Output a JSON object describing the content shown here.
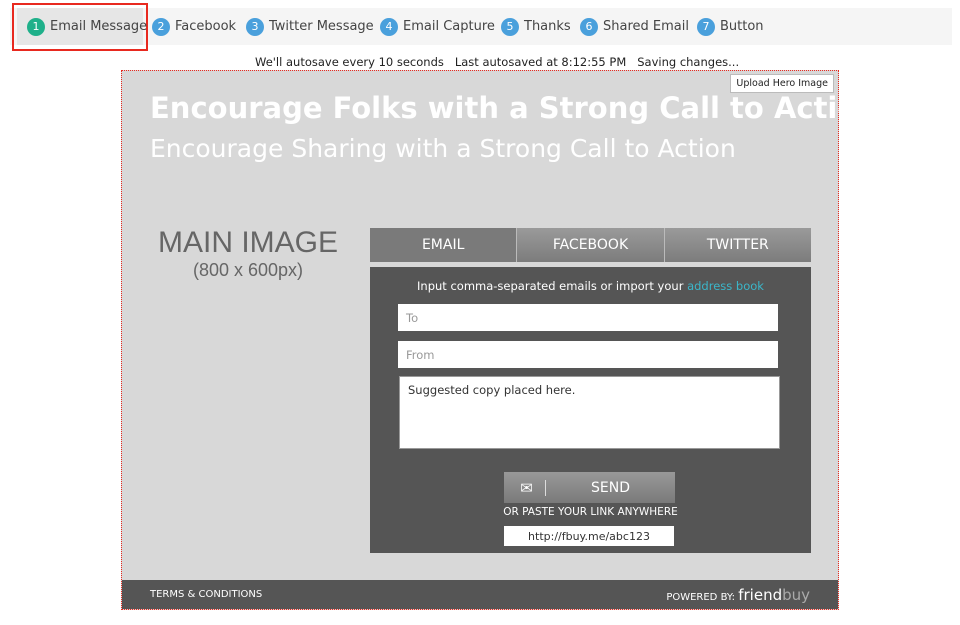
{
  "nav": {
    "items": [
      {
        "num": "1",
        "label": "Email Message",
        "color": "#1fb08a"
      },
      {
        "num": "2",
        "label": "Facebook"
      },
      {
        "num": "3",
        "label": "Twitter Message"
      },
      {
        "num": "4",
        "label": "Email Capture"
      },
      {
        "num": "5",
        "label": "Thanks"
      },
      {
        "num": "6",
        "label": "Shared Email"
      },
      {
        "num": "7",
        "label": "Button"
      }
    ]
  },
  "status": {
    "autosave": "We'll autosave every 10 seconds",
    "last": "Last autosaved at 8:12:55 PM",
    "saving": "Saving changes..."
  },
  "canvas": {
    "upload_label": "Upload Hero Image",
    "headline": "Encourage Folks with a Strong Call to Action",
    "subheadline": "Encourage Sharing with a Strong Call to Action",
    "main_image": "MAIN IMAGE",
    "main_image_size": "(800 x 600px)"
  },
  "tabs": [
    "EMAIL",
    "FACEBOOK",
    "TWITTER"
  ],
  "form": {
    "instructions": "Input comma-separated emails or import your ",
    "address_link": "address book",
    "to_placeholder": "To",
    "from_placeholder": "From",
    "message": "Suggested copy placed here.",
    "send_label": "SEND",
    "paste_label": "OR PASTE YOUR LINK ANYWHERE",
    "link": "http://fbuy.me/abc123"
  },
  "footer": {
    "terms": "TERMS & CONDITIONS",
    "powered": "POWERED BY:",
    "brand_a": "friend",
    "brand_b": "buy"
  }
}
